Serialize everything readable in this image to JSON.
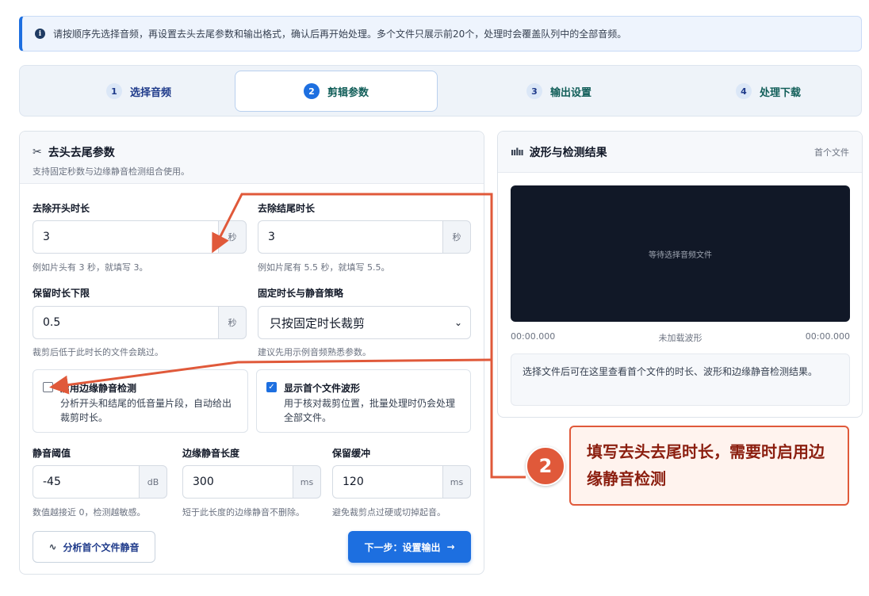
{
  "banner": {
    "text": "请按顺序先选择音频，再设置去头去尾参数和输出格式，确认后再开始处理。多个文件只展示前20个，处理时会覆盖队列中的全部音频。"
  },
  "steps": [
    {
      "num": "1",
      "label": "选择音频"
    },
    {
      "num": "2",
      "label": "剪辑参数"
    },
    {
      "num": "3",
      "label": "输出设置"
    },
    {
      "num": "4",
      "label": "处理下载"
    }
  ],
  "trim_panel": {
    "title": "去头去尾参数",
    "subtitle": "支持固定秒数与边缘静音检测组合使用。",
    "head_trim": {
      "label": "去除开头时长",
      "value": "3",
      "unit": "秒",
      "hint": "例如片头有 3 秒，就填写 3。"
    },
    "tail_trim": {
      "label": "去除结尾时长",
      "value": "3",
      "unit": "秒",
      "hint": "例如片尾有 5.5 秒，就填写 5.5。"
    },
    "min_keep": {
      "label": "保留时长下限",
      "value": "0.5",
      "unit": "秒",
      "hint": "裁剪后低于此时长的文件会跳过。"
    },
    "strategy": {
      "label": "固定时长与静音策略",
      "value": "只按固定时长裁剪",
      "hint": "建议先用示例音频熟悉参数。"
    },
    "silence_check": {
      "title": "启用边缘静音检测",
      "desc": "分析开头和结尾的低音量片段，自动给出裁剪时长。",
      "checked": false
    },
    "show_wave": {
      "title": "显示首个文件波形",
      "desc": "用于核对裁剪位置，批量处理时仍会处理全部文件。",
      "checked": true
    },
    "threshold": {
      "label": "静音阈值",
      "value": "-45",
      "unit": "dB",
      "hint": "数值越接近 0，检测越敏感。"
    },
    "silence_len": {
      "label": "边缘静音长度",
      "value": "300",
      "unit": "ms",
      "hint": "短于此长度的边缘静音不删除。"
    },
    "buffer": {
      "label": "保留缓冲",
      "value": "120",
      "unit": "ms",
      "hint": "避免裁剪点过硬或切掉起音。"
    },
    "analyze_button": "分析首个文件静音",
    "next_button": "下一步：设置输出"
  },
  "wave_panel": {
    "title": "波形与检测结果",
    "badge": "首个文件",
    "placeholder": "等待选择音频文件",
    "time_start": "00:00.000",
    "status": "未加载波形",
    "time_end": "00:00.000",
    "result": "选择文件后可在这里查看首个文件的时长、波形和边缘静音检测结果。"
  },
  "annotation": {
    "number": "2",
    "text": "填写去头去尾时长，需要时启用边缘静音检测",
    "color": "#e0593a"
  }
}
